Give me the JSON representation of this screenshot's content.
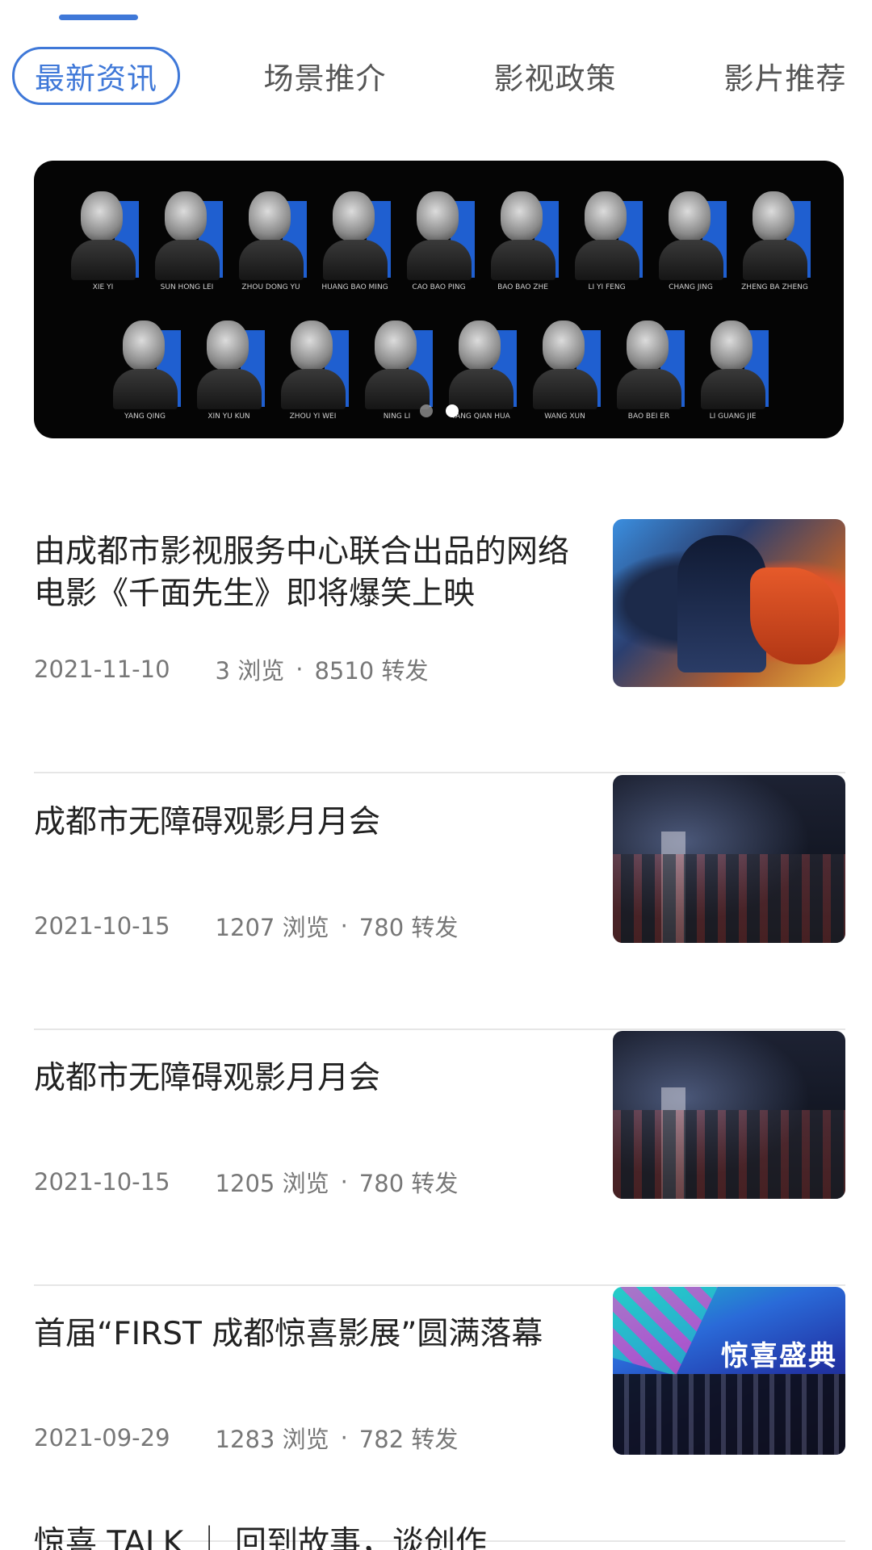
{
  "tabs": [
    {
      "label": "最新资讯",
      "active": true
    },
    {
      "label": "场景推介",
      "active": false
    },
    {
      "label": "影视政策",
      "active": false
    },
    {
      "label": "影片推荐",
      "active": false
    }
  ],
  "banner": {
    "row1_names": [
      "XIE YI",
      "SUN HONG LEI",
      "ZHOU DONG YU",
      "HUANG BAO MING",
      "CAO BAO PING",
      "BAO BAO ZHE",
      "LI YI FENG",
      "CHANG JING",
      "ZHENG BA ZHENG"
    ],
    "row2_names": [
      "YANG QING",
      "XIN YU KUN",
      "ZHOU YI WEI",
      "NING LI",
      "YANG QIAN HUA",
      "WANG XUN",
      "BAO BEI ER",
      "LI GUANG JIE"
    ],
    "carousel_count": 2,
    "carousel_active": 1
  },
  "news": [
    {
      "title": "由成都市影视服务中心联合出品的网络电影《千面先生》即将爆笑上映",
      "date": "2021-11-10",
      "views": "3 浏览",
      "shares": "8510 转发",
      "thumb": "movie-poster"
    },
    {
      "title": "成都市无障碍观影月月会",
      "date": "2021-10-15",
      "views": "1207 浏览",
      "shares": "780 转发",
      "thumb": "cinema"
    },
    {
      "title": "成都市无障碍观影月月会",
      "date": "2021-10-15",
      "views": "1205 浏览",
      "shares": "780 转发",
      "thumb": "cinema"
    },
    {
      "title": "首届“FIRST 成都惊喜影展”圆满落幕",
      "date": "2021-09-29",
      "views": "1283 浏览",
      "shares": "782 转发",
      "thumb": "first-festival",
      "thumb_text": "惊喜盛典"
    }
  ],
  "partial_item": {
    "title": "惊喜 TALK ｜ 回到故事，谈创作"
  },
  "meta_separator": "·",
  "colors": {
    "accent": "#3f78d8",
    "meta": "#777777",
    "divider": "#e6e6e6"
  }
}
